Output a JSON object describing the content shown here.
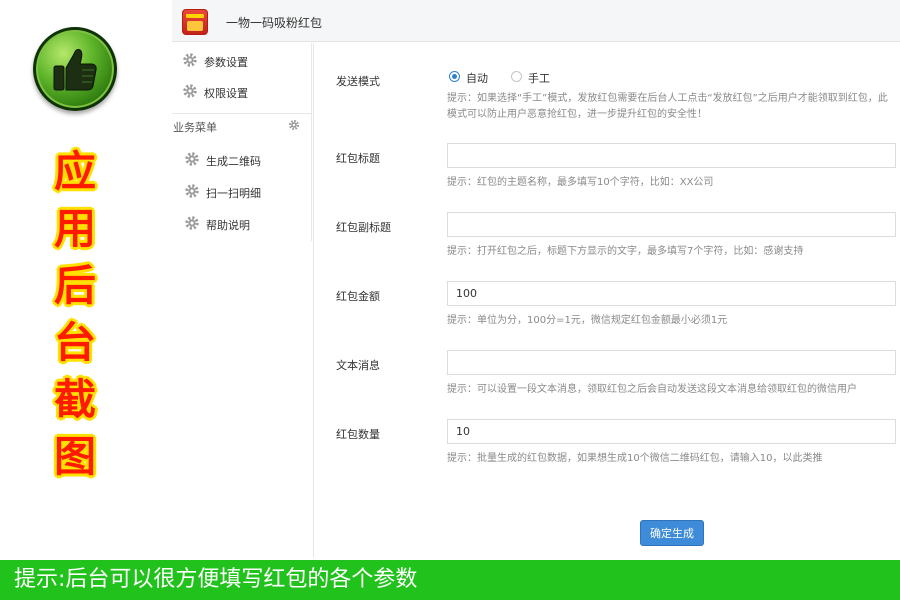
{
  "promo": {
    "icon": "thumbs-up-icon",
    "chars": [
      "应",
      "用",
      "后",
      "台",
      "截",
      "图"
    ],
    "text_color": "#ff1a00",
    "outline_color": "#ffe100"
  },
  "header": {
    "logo_icon": "red-packet-logo-icon",
    "title": "一物一码吸粉红包"
  },
  "sidebar": {
    "items": [
      {
        "label": "参数设置",
        "icon": "gear-icon"
      },
      {
        "label": "权限设置",
        "icon": "gear-icon"
      }
    ],
    "section": {
      "label": "业务菜单",
      "icon": "gear-icon"
    },
    "sub_items": [
      {
        "label": "生成二维码",
        "icon": "gear-icon"
      },
      {
        "label": "扫一扫明细",
        "icon": "gear-icon"
      },
      {
        "label": "帮助说明",
        "icon": "gear-icon"
      }
    ]
  },
  "form": {
    "send_mode": {
      "label": "发送模式",
      "options": [
        {
          "label": "自动",
          "selected": true
        },
        {
          "label": "手工",
          "selected": false
        }
      ],
      "hint": "提示：如果选择“手工”模式，发放红包需要在后台人工点击“发放红包”之后用户才能领取到红包，此模式可以防止用户恶意抢红包，进一步提升红包的安全性！"
    },
    "title": {
      "label": "红包标题",
      "value": "",
      "hint": "提示：红包的主题名称，最多填写10个字符，比如：XX公司"
    },
    "subtitle": {
      "label": "红包副标题",
      "value": "",
      "hint": "提示：打开红包之后，标题下方显示的文字，最多填写7个字符，比如：感谢支持"
    },
    "amount": {
      "label": "红包金额",
      "value": "100",
      "hint": "提示：单位为分，100分=1元，微信规定红包金额最小必须1元"
    },
    "message": {
      "label": "文本消息",
      "value": "",
      "hint": "提示：可以设置一段文本消息，领取红包之后会自动发送这段文本消息给领取红包的微信用户"
    },
    "quantity": {
      "label": "红包数量",
      "value": "10",
      "hint": "提示：批量生成的红包数据，如果想生成10个微信二维码红包，请输入10，以此类推"
    },
    "submit_label": "确定生成",
    "accent_color": "#3d8bd9"
  },
  "banner": {
    "text": "提示:后台可以很方便填写红包的各个参数",
    "background": "#22c21d"
  }
}
